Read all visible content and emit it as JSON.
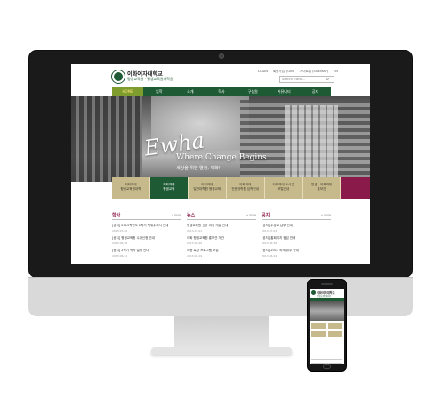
{
  "site": {
    "logo_name": "이화여자대학교",
    "logo_sub": "평생교육원 · 평생교육원대학원",
    "util_links": [
      "LOGIN",
      "회원가입 (JOIN)",
      "사이트맵 (SITEMAP)",
      "EN"
    ],
    "search_placeholder": "Search Ewha..."
  },
  "nav": [
    "HOME",
    "입학",
    "소개",
    "학사",
    "구성원",
    "커뮤니티",
    "공지"
  ],
  "hero": {
    "script": "Ewha",
    "tagline_en": "Where Change Begins",
    "tagline_kr": "세상을 위한 열정, 이화!"
  },
  "quick_links": [
    "이화여대\n평생교육원대학",
    "이화여대\n평생교육",
    "이화여대\n일반대학원 평생교육",
    "이화여대\n전문대학원 입학안내",
    "이화여대 도서관\n포털안내",
    "평생 · 이화여대\n홍보관"
  ],
  "columns": [
    {
      "head": "학사",
      "more": "+ more",
      "items": [
        {
          "title": "[공지] 2013학년도 2학기 학위수여식 안내",
          "date": "2013.07.02"
        },
        {
          "title": "[공지] 평생교육원 수강신청 안내",
          "date": "2013.06.28"
        },
        {
          "title": "[공지] 2학기 학사 일정 안내",
          "date": "2013.06.21"
        }
      ]
    },
    {
      "head": "뉴스",
      "more": "+ more",
      "items": [
        {
          "title": "평생교육원 신규 과정 개설 안내",
          "date": "2013.07.01"
        },
        {
          "title": "이화 평생교육원 홍보관 개관",
          "date": "2013.06.26"
        },
        {
          "title": "여름 특강 프로그램 모집",
          "date": "2013.06.19"
        }
      ]
    },
    {
      "head": "공지",
      "more": "+ more",
      "items": [
        {
          "title": "[공지] 수강료 납부 안내",
          "date": "2013.07.03"
        },
        {
          "title": "[공지] 홈페이지 점검 안내",
          "date": "2013.06.30"
        },
        {
          "title": "[공지] 2013 하계 휴무 안내",
          "date": "2013.06.24"
        }
      ]
    }
  ],
  "mobile": {
    "logo_name": "이화여자대학교",
    "logo_sub": "평생교육원대학"
  }
}
